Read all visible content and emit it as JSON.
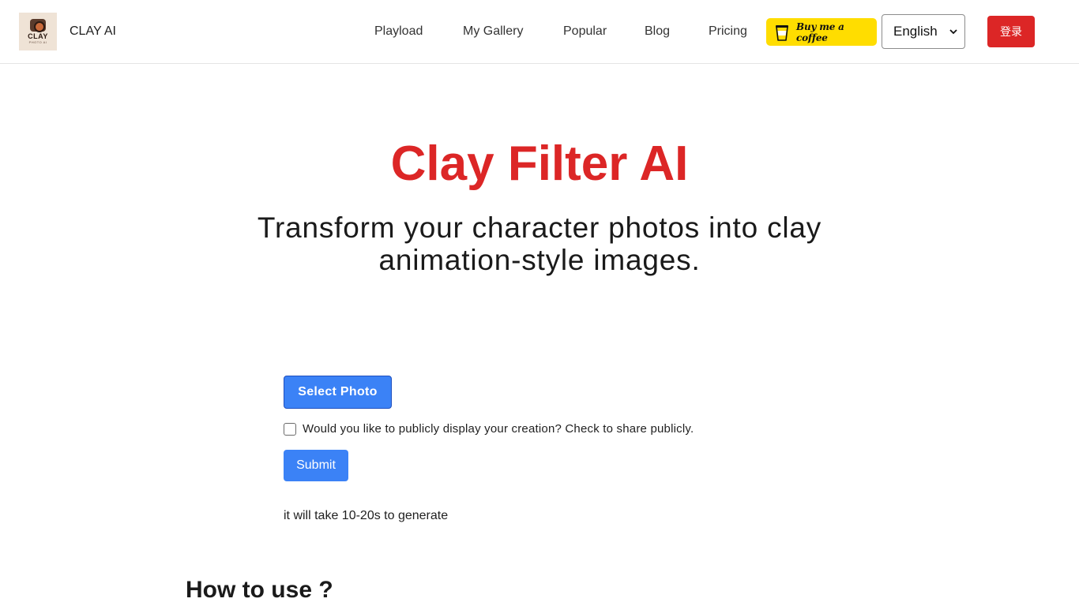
{
  "header": {
    "brand": "CLAY AI",
    "logo": {
      "text": "CLAY",
      "sub": "PHOTO AI",
      "icon": "camera-icon"
    },
    "nav": [
      "Playload",
      "My Gallery",
      "Popular",
      "Blog",
      "Pricing"
    ],
    "coffee_label": "Buy me a coffee",
    "language": "English",
    "login_label": "登录",
    "colors": {
      "login_bg": "#dc2626",
      "coffee_bg": "#ffdd00"
    }
  },
  "hero": {
    "title": "Clay Filter AI",
    "subtitle": "Transform your character photos into clay animation-style images.",
    "title_color": "#dc2626"
  },
  "form": {
    "select_photo_label": "Select Photo",
    "public_checkbox_label": "Would you like to publicly display your creation? Check to share publicly.",
    "public_checked": false,
    "submit_label": "Submit",
    "note": "it will take 10-20s to generate",
    "button_color": "#3b82f6"
  },
  "howto": {
    "heading": "How to use ?"
  }
}
